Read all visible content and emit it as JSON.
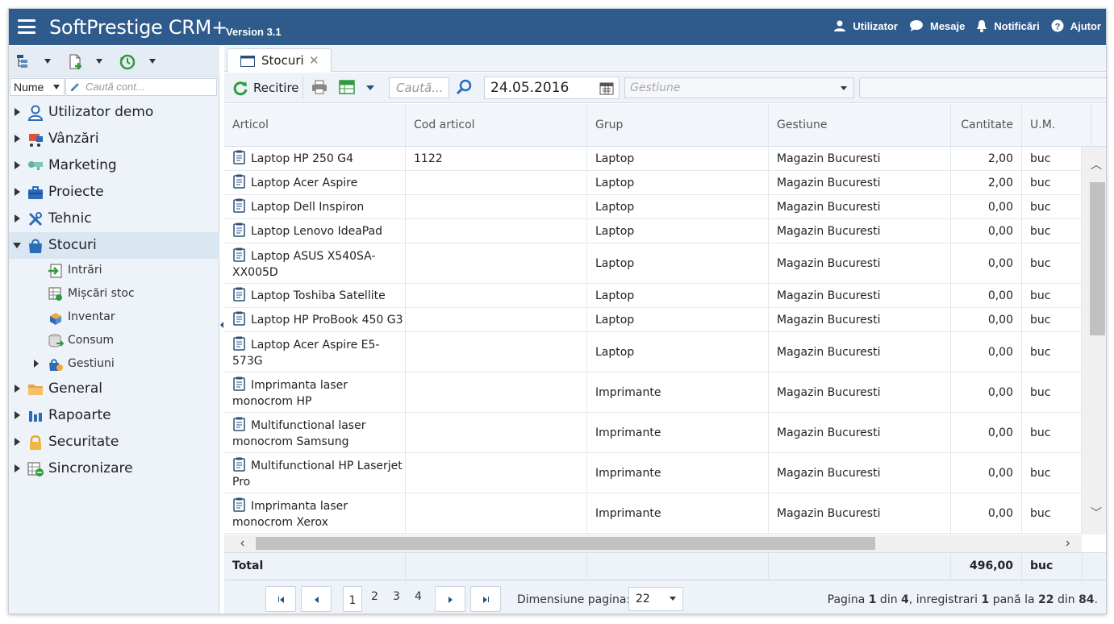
{
  "header": {
    "title": "SoftPrestige CRM+",
    "version": "Version 3.1",
    "menu": [
      {
        "label": "Utilizator",
        "icon": "user-icon"
      },
      {
        "label": "Mesaje",
        "icon": "chat-icon"
      },
      {
        "label": "Notificări",
        "icon": "bell-icon"
      },
      {
        "label": "Ajutor",
        "icon": "help-icon"
      }
    ]
  },
  "sidebar": {
    "search_field": "Nume",
    "search_placeholder": "Caută cont...",
    "items": [
      {
        "label": "Utilizator demo",
        "icon": "user-demo-icon"
      },
      {
        "label": "Vânzări",
        "icon": "cart-icon"
      },
      {
        "label": "Marketing",
        "icon": "marketing-icon"
      },
      {
        "label": "Proiecte",
        "icon": "briefcase-icon"
      },
      {
        "label": "Tehnic",
        "icon": "tools-icon"
      },
      {
        "label": "Stocuri",
        "icon": "bag-icon",
        "active": true
      }
    ],
    "subitems": [
      {
        "label": "Intrări",
        "icon": "entry-icon"
      },
      {
        "label": "Mișcări stoc",
        "icon": "stock-move-icon"
      },
      {
        "label": "Inventar",
        "icon": "inventory-icon"
      },
      {
        "label": "Consum",
        "icon": "consumption-icon"
      },
      {
        "label": "Gestiuni",
        "icon": "warehouse-icon"
      }
    ],
    "items_after": [
      {
        "label": "General",
        "icon": "folder-icon"
      },
      {
        "label": "Rapoarte",
        "icon": "chart-icon"
      },
      {
        "label": "Securitate",
        "icon": "lock-icon"
      },
      {
        "label": "Sincronizare",
        "icon": "sync-icon"
      }
    ]
  },
  "tab": {
    "label": "Stocuri",
    "close": "✕"
  },
  "toolbar": {
    "reload_label": "Recitire",
    "search_placeholder": "Caută...",
    "date_value": "24.05.2016",
    "gestiune_placeholder": "Gestiune"
  },
  "grid": {
    "columns": [
      "Articol",
      "Cod articol",
      "Grup",
      "Gestiune",
      "Cantitate",
      "U.M."
    ],
    "rows": [
      {
        "articol": "Laptop HP 250 G4",
        "cod": "1122",
        "grup": "Laptop",
        "gestiune": "Magazin Bucuresti",
        "cantitate": "2,00",
        "um": "buc"
      },
      {
        "articol": "Laptop Acer Aspire",
        "cod": "",
        "grup": "Laptop",
        "gestiune": "Magazin Bucuresti",
        "cantitate": "2,00",
        "um": "buc"
      },
      {
        "articol": "Laptop Dell Inspiron",
        "cod": "",
        "grup": "Laptop",
        "gestiune": "Magazin Bucuresti",
        "cantitate": "0,00",
        "um": "buc"
      },
      {
        "articol": "Laptop Lenovo IdeaPad",
        "cod": "",
        "grup": "Laptop",
        "gestiune": "Magazin Bucuresti",
        "cantitate": "0,00",
        "um": "buc"
      },
      {
        "articol": "Laptop ASUS X540SA-",
        "articol2": "XX005D",
        "cod": "",
        "grup": "Laptop",
        "gestiune": "Magazin Bucuresti",
        "cantitate": "0,00",
        "um": "buc"
      },
      {
        "articol": "Laptop Toshiba Satellite",
        "cod": "",
        "grup": "Laptop",
        "gestiune": "Magazin Bucuresti",
        "cantitate": "0,00",
        "um": "buc"
      },
      {
        "articol": "Laptop HP ProBook 450 G3",
        "cod": "",
        "grup": "Laptop",
        "gestiune": "Magazin Bucuresti",
        "cantitate": "0,00",
        "um": "buc"
      },
      {
        "articol": "Laptop Acer Aspire E5-",
        "articol2": "573G",
        "cod": "",
        "grup": "Laptop",
        "gestiune": "Magazin Bucuresti",
        "cantitate": "0,00",
        "um": "buc"
      },
      {
        "articol": "Imprimanta laser",
        "articol2": "monocrom HP",
        "cod": "",
        "grup": "Imprimante",
        "gestiune": "Magazin Bucuresti",
        "cantitate": "0,00",
        "um": "buc"
      },
      {
        "articol": "Multifunctional laser",
        "articol2": "monocrom Samsung",
        "cod": "",
        "grup": "Imprimante",
        "gestiune": "Magazin Bucuresti",
        "cantitate": "0,00",
        "um": "buc"
      },
      {
        "articol": "Multifunctional HP Laserjet",
        "articol2": "Pro",
        "cod": "",
        "grup": "Imprimante",
        "gestiune": "Magazin Bucuresti",
        "cantitate": "0,00",
        "um": "buc"
      },
      {
        "articol": "Imprimanta laser",
        "articol2": "monocrom Xerox",
        "cod": "",
        "grup": "Imprimante",
        "gestiune": "Magazin Bucuresti",
        "cantitate": "0,00",
        "um": "buc"
      }
    ],
    "total_label": "Total",
    "total_cantitate": "496,00",
    "total_um": "buc"
  },
  "pager": {
    "pages": [
      "1",
      "2",
      "3",
      "4"
    ],
    "current_page": "1",
    "page_size_label": "Dimensiune pagina:",
    "page_size": "22",
    "info_prefix": "Pagina ",
    "info_page": "1",
    "info_mid1": " din ",
    "info_pages": "4",
    "info_mid2": ", inregistrari ",
    "info_from": "1",
    "info_mid3": " pană la ",
    "info_to": "22",
    "info_mid4": " din ",
    "info_total": "84",
    "info_end": "."
  },
  "colors": {
    "header_bg": "#2f5a8c",
    "sidebar_bg": "#eef3f9",
    "accent": "#2b4f7c"
  }
}
